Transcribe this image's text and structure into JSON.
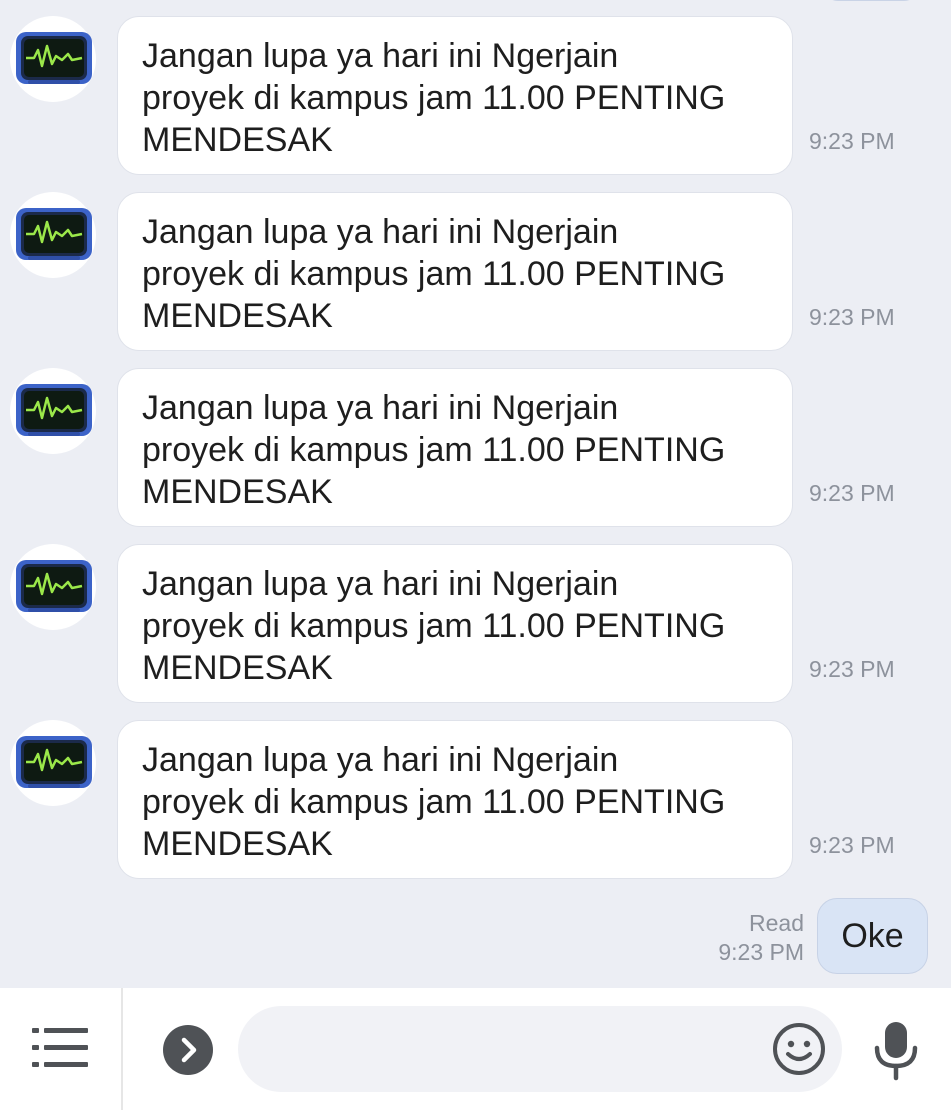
{
  "chat": {
    "messages": [
      {
        "sender": "bot",
        "avatar_icon": "heartbeat-monitor-icon",
        "text": "Jangan lupa ya hari ini Ngerjain\nproyek di kampus jam 11.00 PENTING\nMENDESAK",
        "time": "9:23 PM"
      },
      {
        "sender": "bot",
        "avatar_icon": "heartbeat-monitor-icon",
        "text": "Jangan lupa ya hari ini Ngerjain\nproyek di kampus jam 11.00 PENTING\nMENDESAK",
        "time": "9:23 PM"
      },
      {
        "sender": "bot",
        "avatar_icon": "heartbeat-monitor-icon",
        "text": "Jangan lupa ya hari ini Ngerjain\nproyek di kampus jam 11.00 PENTING\nMENDESAK",
        "time": "9:23 PM"
      },
      {
        "sender": "bot",
        "avatar_icon": "heartbeat-monitor-icon",
        "text": "Jangan lupa ya hari ini Ngerjain\nproyek di kampus jam 11.00 PENTING\nMENDESAK",
        "time": "9:23 PM"
      },
      {
        "sender": "bot",
        "avatar_icon": "heartbeat-monitor-icon",
        "text": "Jangan lupa ya hari ini Ngerjain\nproyek di kampus jam 11.00 PENTING\nMENDESAK",
        "time": "9:23 PM"
      }
    ],
    "own_message": {
      "text": "Oke",
      "read_label": "Read",
      "time": "9:23 PM"
    }
  },
  "input_bar": {
    "menu_icon": "menu-lines-icon",
    "expand_icon": "chevron-right-icon",
    "message_value": "",
    "emoji_icon": "smiley-icon",
    "mic_icon": "microphone-icon"
  },
  "colors": {
    "background": "#eceef4",
    "incoming_bubble": "#ffffff",
    "outgoing_bubble": "#d9e4f5",
    "timestamp": "#8d929c",
    "avatar_screen_line": "#9be84a",
    "avatar_frame": "#3c63c8"
  }
}
